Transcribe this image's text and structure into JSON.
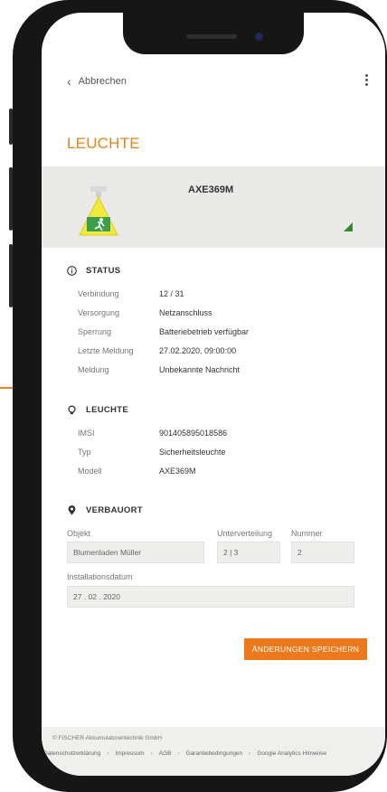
{
  "header": {
    "back_label": "Abbrechen",
    "page_title": "LEUCHTE"
  },
  "device": {
    "name": "AXE369M",
    "signal_color": "#2f8a2f"
  },
  "status": {
    "title": "STATUS",
    "rows": [
      {
        "key": "Verbindung",
        "value": "12 / 31"
      },
      {
        "key": "Versorgung",
        "value": "Netzanschluss"
      },
      {
        "key": "Sperrung",
        "value": "Batteriebetrieb verfügbar"
      },
      {
        "key": "Letzte Meldung",
        "value": "27.02.2020, 09:00:00"
      },
      {
        "key": "Meldung",
        "value": "Unbekannte Nachricht"
      }
    ]
  },
  "leuchte": {
    "title": "LEUCHTE",
    "rows": [
      {
        "key": "IMSI",
        "value": "901405895018586"
      },
      {
        "key": "Typ",
        "value": "Sicherheitsleuchte"
      },
      {
        "key": "Modell",
        "value": "AXE369M"
      }
    ]
  },
  "verbauort": {
    "title": "VERBAUORT",
    "objekt_label": "Objekt",
    "objekt_value": "Blumenladen Müller",
    "unterverteilung_label": "Unterverteilung",
    "unterverteilung_value": "2 | 3",
    "nummer_label": "Nummer",
    "nummer_value": "2",
    "datum_label": "Installationsdatum",
    "datum_value": "27 . 02 . 2020"
  },
  "actions": {
    "save_label": "ÄNDERUNGEN SPEICHERN"
  },
  "footer": {
    "copyright": "© FISCHER Akkumulatorentechnik GmbH",
    "links": [
      "Datenschutzerklärung",
      "Impressum",
      "AGB",
      "Garantiebedingungen",
      "Google Analytics Hinweise"
    ],
    "separator": "›"
  },
  "colors": {
    "accent": "#e8821e",
    "button": "#ec7a1c"
  }
}
